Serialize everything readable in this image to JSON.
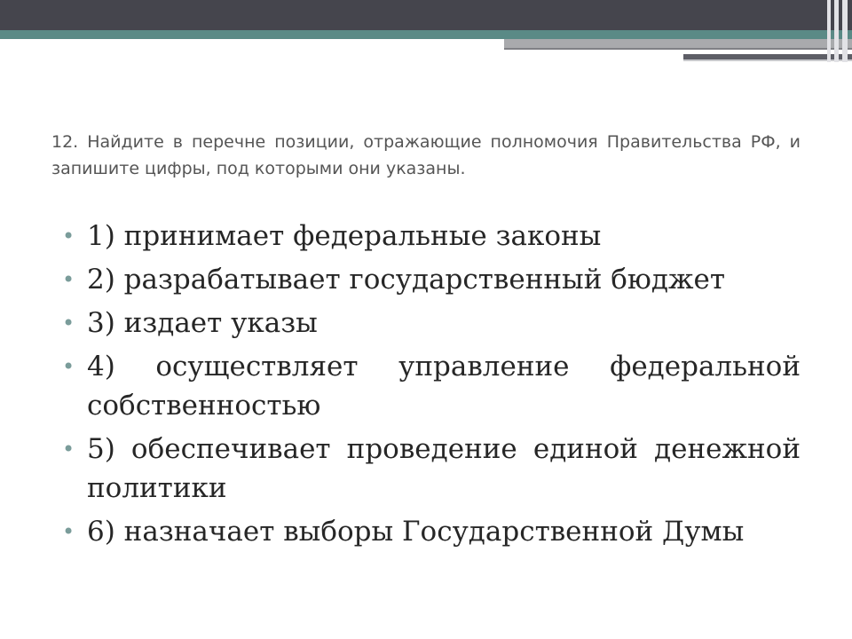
{
  "slide": {
    "question": "12. Найдите в перечне позиции, отражающие полномочия Правительства РФ, и запишите цифры, под которыми они указаны.",
    "bullet_glyph": "•",
    "options": [
      "1) принимает федеральные законы",
      "2) разрабатывает государственный бюджет",
      "3) издает указы",
      "4) осуществляет управление федеральной собственностью",
      "5) обеспечивает проведение единой денежной политики",
      "6) назначает выборы Государственной Думы"
    ]
  },
  "colors": {
    "header_dark": "#45454d",
    "header_teal": "#5a8a86",
    "header_gray": "#a9aaad",
    "bullet": "#7a9c9a",
    "question_text": "#555555",
    "option_text": "#262626"
  }
}
